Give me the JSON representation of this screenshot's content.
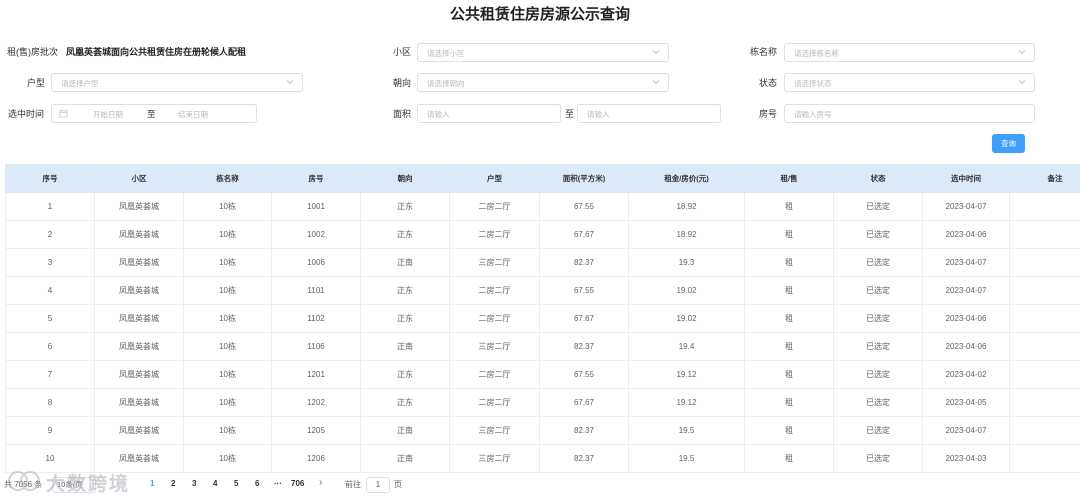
{
  "page": {
    "title": "公共租赁住房房源公示查询"
  },
  "filters": {
    "batch": {
      "label": "租(售)房批次",
      "value": "凤凰英荟城面向公共租赁住房在册轮候人配租"
    },
    "community": {
      "label": "小区",
      "placeholder": "请选择小区"
    },
    "building": {
      "label": "栋名称",
      "placeholder": "请选择栋名称"
    },
    "layout": {
      "label": "户型",
      "placeholder": "请选择户型"
    },
    "orientation": {
      "label": "朝向",
      "placeholder": "请选择朝向"
    },
    "status": {
      "label": "状态",
      "placeholder": "请选择状态"
    },
    "selected_time": {
      "label": "选中时间",
      "start_placeholder": "开始日期",
      "separator": "至",
      "end_placeholder": "结束日期"
    },
    "area": {
      "label": "面积",
      "min_placeholder": "请输入",
      "separator": "至",
      "max_placeholder": "请输入"
    },
    "room": {
      "label": "房号",
      "placeholder": "请输入房号"
    },
    "query_label": "查询"
  },
  "table": {
    "columns": [
      "序号",
      "小区",
      "栋名称",
      "房号",
      "朝向",
      "户型",
      "面积(平方米)",
      "租金/房价(元)",
      "租/售",
      "状态",
      "选中时间",
      "备注"
    ],
    "rows": [
      [
        "1",
        "凤凰英荟城",
        "10栋",
        "1001",
        "正东",
        "二房二厅",
        "67.55",
        "18.92",
        "租",
        "已选定",
        "2023-04-07",
        ""
      ],
      [
        "2",
        "凤凰英荟城",
        "10栋",
        "1002",
        "正东",
        "二房二厅",
        "67.67",
        "18.92",
        "租",
        "已选定",
        "2023-04-06",
        ""
      ],
      [
        "3",
        "凤凰英荟城",
        "10栋",
        "1006",
        "正南",
        "三房二厅",
        "82.37",
        "19.3",
        "租",
        "已选定",
        "2023-04-07",
        ""
      ],
      [
        "4",
        "凤凰英荟城",
        "10栋",
        "1101",
        "正东",
        "二房二厅",
        "67.55",
        "19.02",
        "租",
        "已选定",
        "2023-04-07",
        ""
      ],
      [
        "5",
        "凤凰英荟城",
        "10栋",
        "1102",
        "正东",
        "二房二厅",
        "67.67",
        "19.02",
        "租",
        "已选定",
        "2023-04-06",
        ""
      ],
      [
        "6",
        "凤凰英荟城",
        "10栋",
        "1106",
        "正南",
        "三房二厅",
        "82.37",
        "19.4",
        "租",
        "已选定",
        "2023-04-06",
        ""
      ],
      [
        "7",
        "凤凰英荟城",
        "10栋",
        "1201",
        "正东",
        "二房二厅",
        "67.55",
        "19.12",
        "租",
        "已选定",
        "2023-04-02",
        ""
      ],
      [
        "8",
        "凤凰英荟城",
        "10栋",
        "1202",
        "正东",
        "二房二厅",
        "67.67",
        "19.12",
        "租",
        "已选定",
        "2023-04-05",
        ""
      ],
      [
        "9",
        "凤凰英荟城",
        "10栋",
        "1205",
        "正南",
        "三房二厅",
        "82.37",
        "19.5",
        "租",
        "已选定",
        "2023-04-07",
        ""
      ],
      [
        "10",
        "凤凰英荟城",
        "10栋",
        "1206",
        "正南",
        "三房二厅",
        "82.37",
        "19.5",
        "租",
        "已选定",
        "2023-04-03",
        ""
      ]
    ]
  },
  "pagination": {
    "total": "共 7056 条",
    "page_size": "10条/页",
    "pages": [
      "1",
      "2",
      "3",
      "4",
      "5",
      "6"
    ],
    "ellipsis": "···",
    "last_page": "706",
    "next": "›",
    "goto_prefix": "前往",
    "goto_value": "1",
    "goto_suffix": "页",
    "active_page": "1"
  },
  "watermark": {
    "text": "大数跨境"
  },
  "colors": {
    "primary": "#409eff",
    "header_bg": "#dbe9f9",
    "border": "#dcdfe6"
  },
  "icons": {
    "select": "chevron-down-icon",
    "date": "calendar-icon",
    "next": "chevron-right-icon"
  }
}
